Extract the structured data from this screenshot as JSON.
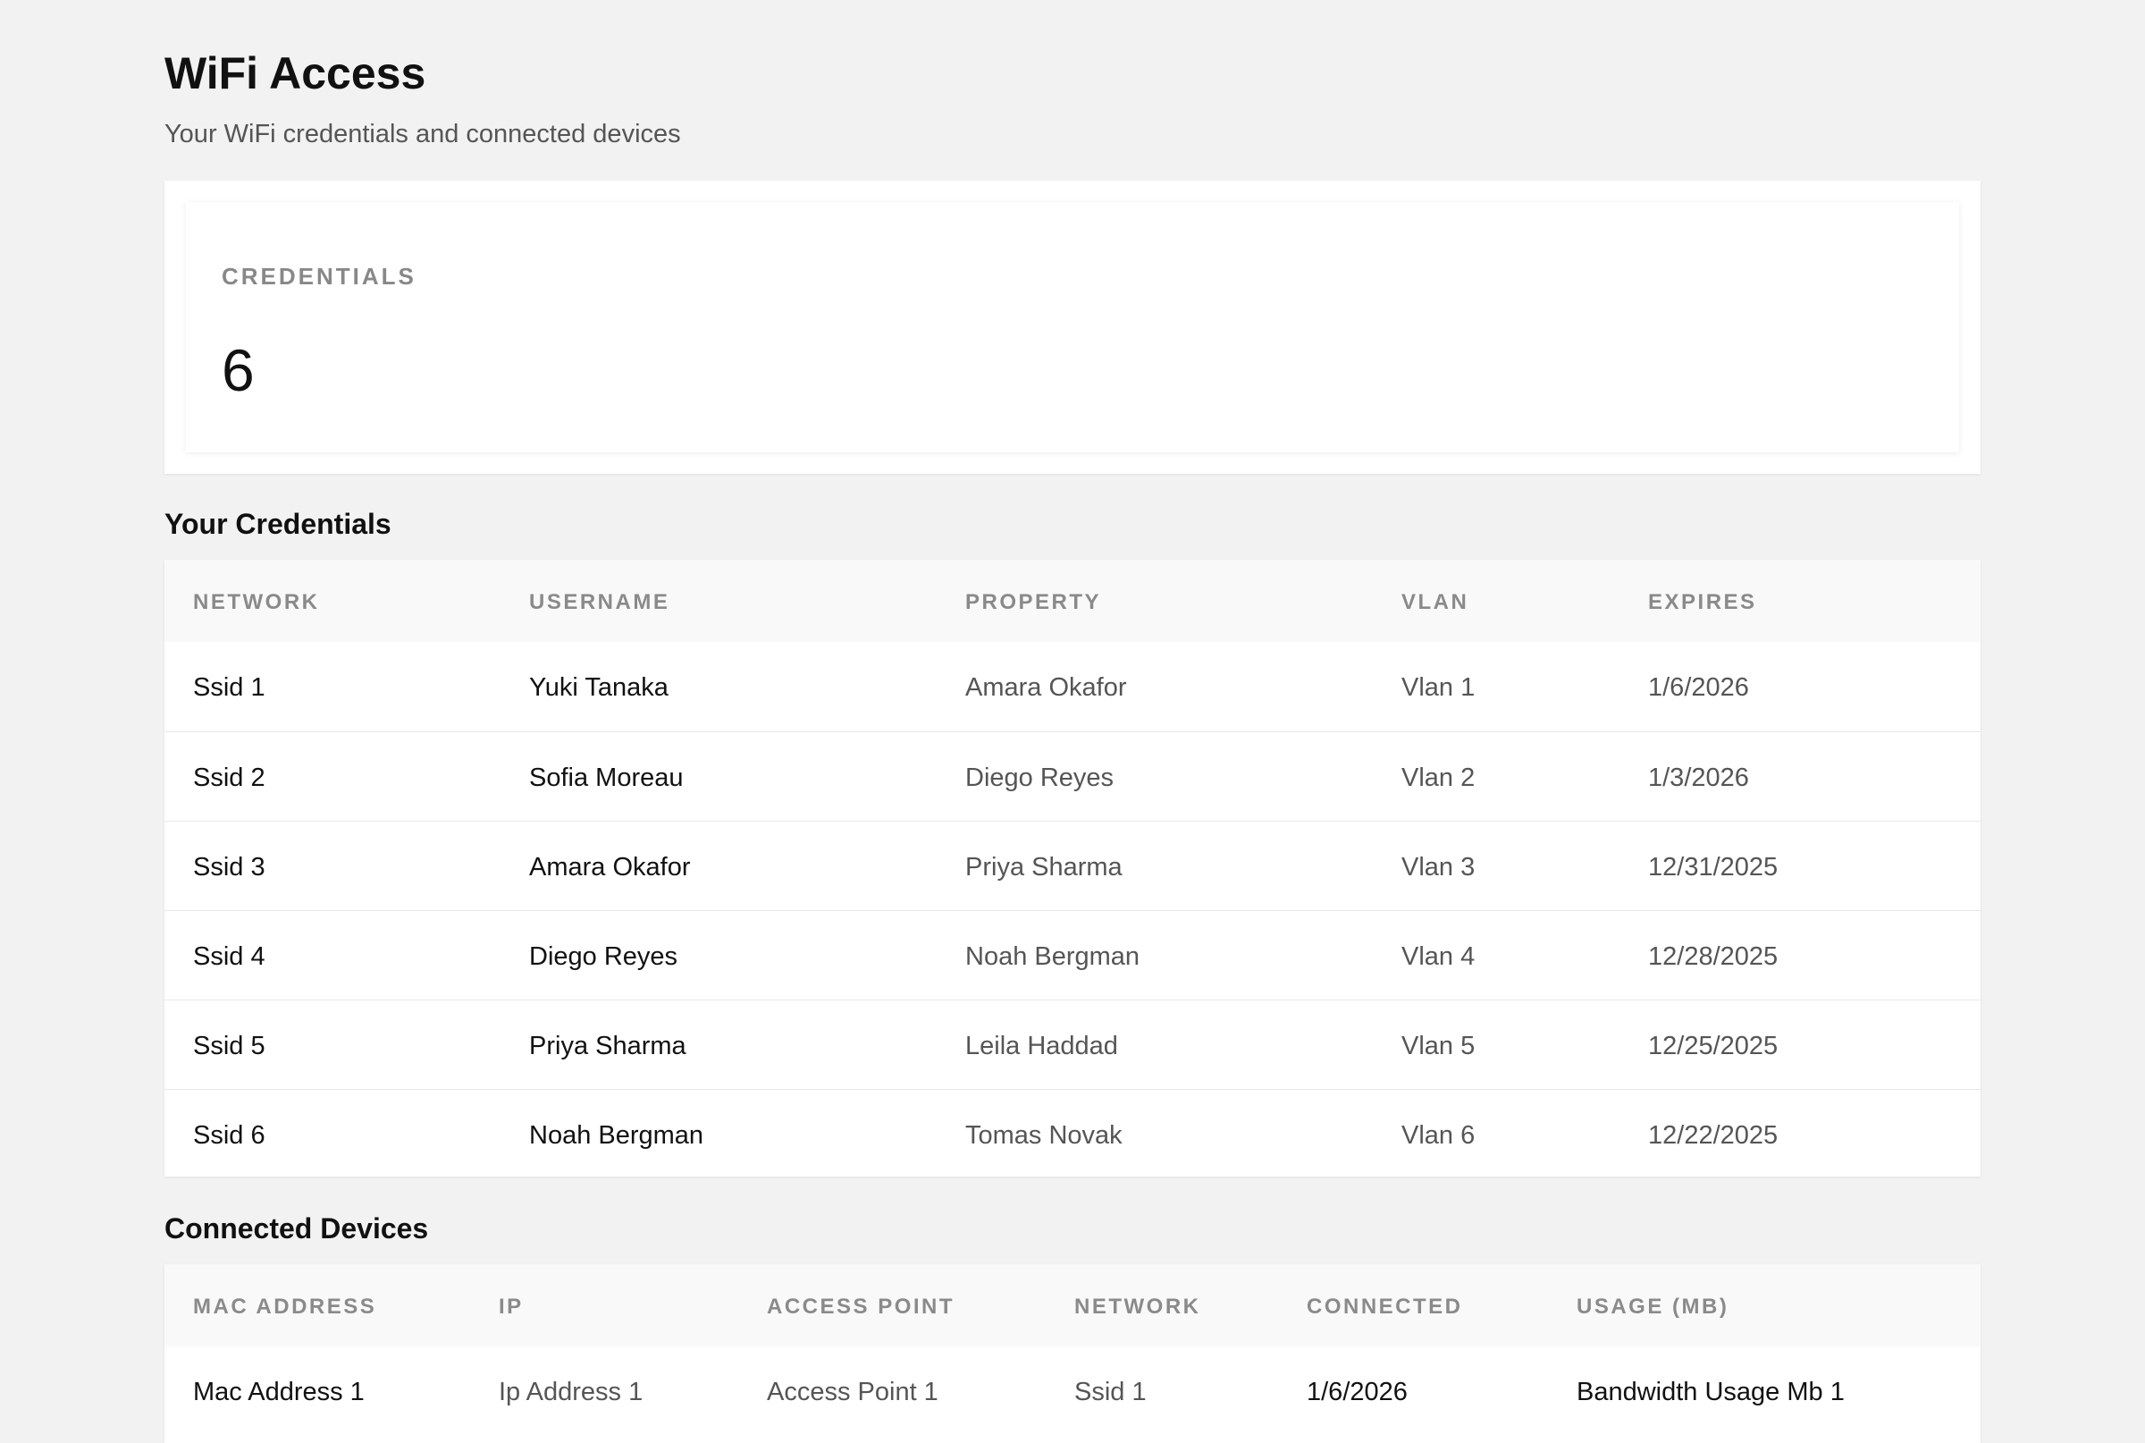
{
  "header": {
    "title": "WiFi Access",
    "subtitle": "Your WiFi credentials and connected devices"
  },
  "stat": {
    "label": "CREDENTIALS",
    "value": "6"
  },
  "credentials_section": {
    "title": "Your Credentials",
    "columns": [
      "NETWORK",
      "USERNAME",
      "PROPERTY",
      "VLAN",
      "EXPIRES"
    ],
    "rows": [
      [
        "Ssid 1",
        "Yuki Tanaka",
        "Amara Okafor",
        "Vlan 1",
        "1/6/2026"
      ],
      [
        "Ssid 2",
        "Sofia Moreau",
        "Diego Reyes",
        "Vlan 2",
        "1/3/2026"
      ],
      [
        "Ssid 3",
        "Amara Okafor",
        "Priya Sharma",
        "Vlan 3",
        "12/31/2025"
      ],
      [
        "Ssid 4",
        "Diego Reyes",
        "Noah Bergman",
        "Vlan 4",
        "12/28/2025"
      ],
      [
        "Ssid 5",
        "Priya Sharma",
        "Leila Haddad",
        "Vlan 5",
        "12/25/2025"
      ],
      [
        "Ssid 6",
        "Noah Bergman",
        "Tomas Novak",
        "Vlan 6",
        "12/22/2025"
      ]
    ]
  },
  "devices_section": {
    "title": "Connected Devices",
    "columns": [
      "MAC ADDRESS",
      "IP",
      "ACCESS POINT",
      "NETWORK",
      "CONNECTED",
      "USAGE (MB)"
    ],
    "rows": [
      [
        "Mac Address 1",
        "Ip Address 1",
        "Access Point 1",
        "Ssid 1",
        "1/6/2026",
        "Bandwidth Usage Mb 1"
      ]
    ]
  }
}
